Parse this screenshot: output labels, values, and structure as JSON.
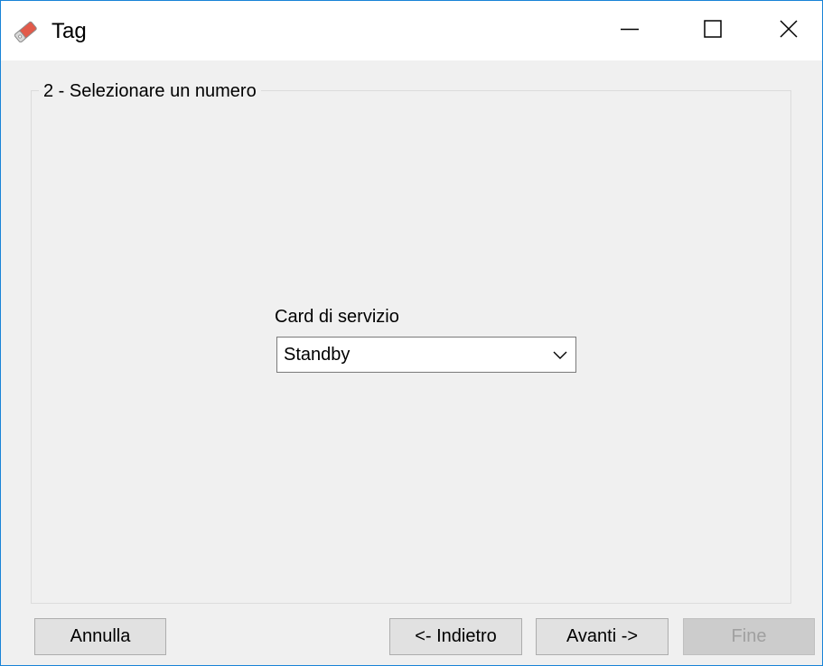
{
  "window": {
    "title": "Tag",
    "icon": "tag-icon",
    "accent_color": "#1883d7"
  },
  "caption_buttons": {
    "minimize": "minimize-icon",
    "maximize": "maximize-icon",
    "close": "close-icon"
  },
  "group": {
    "title": "2 - Selezionare un numero"
  },
  "field": {
    "label": "Card di servizio",
    "selected_value": "Standby"
  },
  "buttons": {
    "cancel": "Annulla",
    "back": "<- Indietro",
    "next": "Avanti ->",
    "finish": "Fine",
    "finish_enabled": false
  }
}
